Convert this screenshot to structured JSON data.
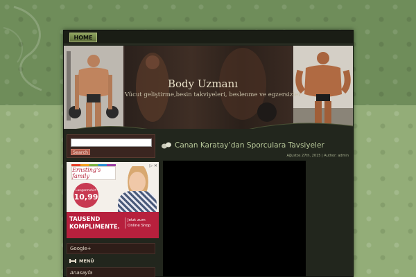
{
  "nav": {
    "home": "HOME"
  },
  "header": {
    "title": "Body Uzmanı",
    "tagline": "Vücut geliştirme,besin takviyeleri, beslenme ve egzersizler"
  },
  "search": {
    "button": "Search",
    "value": ""
  },
  "ad": {
    "brand": "Ernsting's family",
    "price_label": "Langarmshirt",
    "price": "10,99",
    "banner_main": "TAUSEND KOMPLIMENTE.",
    "banner_side": "Jetzt zum Online Shop",
    "icons": "▷ ✕"
  },
  "sidebar": {
    "widget1": "Google+",
    "menu": "MENÜ",
    "widget2": "Anasayfa"
  },
  "post": {
    "title": "Canan Karatay’dan Sporculara Tavsiyeler",
    "meta": "Ağustos 27th, 2015 | Author: admin"
  },
  "colors": {
    "bg_top": "#6f8d5a",
    "bg_bottom": "#93ad78",
    "frame": "#22261d",
    "title_green": "#b8c89a",
    "ad_red": "#b7203d"
  }
}
